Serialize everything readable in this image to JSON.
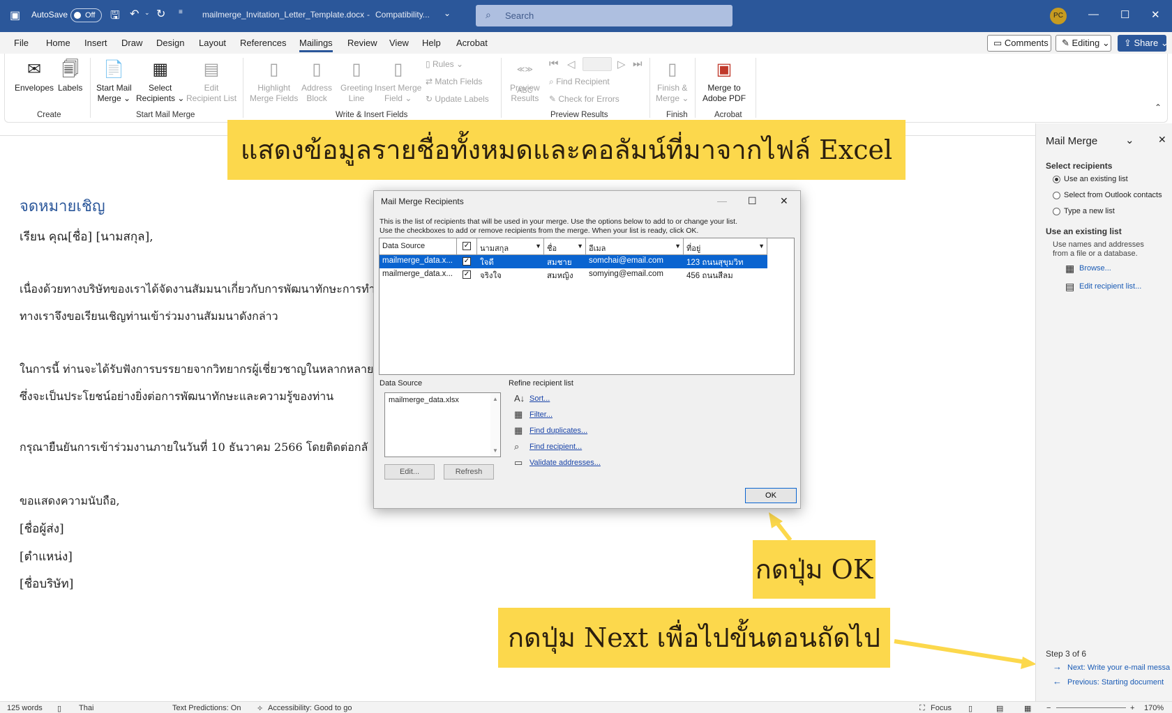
{
  "titlebar": {
    "autosave_label": "AutoSave",
    "autosave_state": "Off",
    "filename": "mailmerge_Invitation_Letter_Template.docx",
    "mode": "Compatibility...",
    "search_placeholder": "Search",
    "avatar": "PC"
  },
  "menu": {
    "tabs": [
      "File",
      "Home",
      "Insert",
      "Draw",
      "Design",
      "Layout",
      "References",
      "Mailings",
      "Review",
      "View",
      "Help",
      "Acrobat"
    ],
    "comments": "Comments",
    "editing": "Editing",
    "share": "Share"
  },
  "ribbon": {
    "envelopes": "Envelopes",
    "labels": "Labels",
    "start_mail_merge": [
      "Start Mail",
      "Merge"
    ],
    "select_recipients": [
      "Select",
      "Recipients"
    ],
    "edit_recipient_list": [
      "Edit",
      "Recipient List"
    ],
    "highlight_merge_fields": [
      "Highlight",
      "Merge Fields"
    ],
    "address_block": [
      "Address",
      "Block"
    ],
    "greeting_line": [
      "Greeting",
      "Line"
    ],
    "insert_merge_field": [
      "Insert Merge",
      "Field"
    ],
    "rules": "Rules",
    "match_fields": "Match Fields",
    "update_labels": "Update Labels",
    "preview_results": [
      "Preview",
      "Results"
    ],
    "find_recipient": "Find Recipient",
    "check_for_errors": "Check for Errors",
    "finish_merge": [
      "Finish &",
      "Merge"
    ],
    "merge_to_pdf": [
      "Merge to",
      "Adobe PDF"
    ],
    "groups": [
      "Create",
      "Start Mail Merge",
      "Write & Insert Fields",
      "Preview Results",
      "Finish",
      "Acrobat"
    ]
  },
  "document": {
    "heading": "จดหมายเชิญ",
    "lines": [
      "เรียน คุณ[ชื่อ] [นามสกุล],",
      "เนื่องด้วยทางบริษัทของเราได้จัดงานสัมมนาเกี่ยวกับการพัฒนาทักษะการทำงา",
      "ทางเราจึงขอเรียนเชิญท่านเข้าร่วมงานสัมมนาดังกล่าว",
      "ในการนี้ ท่านจะได้รับฟังการบรรยายจากวิทยากรผู้เชี่ยวชาญในหลากหลายสา",
      "ซึ่งจะเป็นประโยชน์อย่างยิ่งต่อการพัฒนาทักษะและความรู้ของท่าน",
      "กรุณายืนยันการเข้าร่วมงานภายในวันที่ 10 ธันวาคม 2566 โดยติดต่อกลั",
      "ขอแสดงความนับถือ,",
      "[ชื่อผู้ส่ง]",
      "[ตำแหน่ง]",
      "[ชื่อบริษัท]"
    ]
  },
  "annotations": {
    "top": "แสดงข้อมูลรายชื่อทั้งหมดและคอลัมน์ที่มาจากไฟล์ Excel",
    "ok": "กดปุ่ม OK",
    "next": "กดปุ่ม Next เพื่อไปขั้นตอนถัดไป"
  },
  "dialog": {
    "title": "Mail Merge Recipients",
    "description": [
      "This is the list of recipients that will be used in your merge.  Use the options below to add to or change your list.",
      "Use the checkboxes to add or remove recipients from the merge.  When your list is ready, click OK."
    ],
    "columns": [
      "Data Source",
      "",
      "นามสกุล",
      "ชื่อ",
      "อีเมล",
      "ที่อยู่"
    ],
    "rows": [
      {
        "source": "mailmerge_data.x...",
        "checked": "✓",
        "lastname": "ใจดี",
        "firstname": "สมชาย",
        "email": "somchai@email.com",
        "address": "123 ถนนสุขุมวิท"
      },
      {
        "source": "mailmerge_data.x...",
        "checked": "✓",
        "lastname": "จริงใจ",
        "firstname": "สมหญิง",
        "email": "somying@email.com",
        "address": "456 ถนนสีลม"
      }
    ],
    "data_source_label": "Data Source",
    "data_source_file": "mailmerge_data.xlsx",
    "edit_btn": "Edit...",
    "refresh_btn": "Refresh",
    "refine_label": "Refine recipient list",
    "refine_links": [
      "Sort...",
      "Filter...",
      "Find duplicates...",
      "Find recipient...",
      "Validate addresses..."
    ],
    "ok_btn": "OK"
  },
  "pane": {
    "title": "Mail Merge",
    "select_recipients": "Select recipients",
    "options": [
      "Use an existing list",
      "Select from Outlook contacts",
      "Type a new list"
    ],
    "existing_heading": "Use an existing list",
    "existing_desc": [
      "Use names and addresses",
      "from a file or a database."
    ],
    "browse": "Browse...",
    "edit_list": "Edit recipient list...",
    "step": "Step 3 of 6",
    "next": "Next: Write your e-mail messa",
    "previous": "Previous: Starting document"
  },
  "status": {
    "words": "125 words",
    "language": "Thai",
    "predictions": "Text Predictions: On",
    "accessibility": "Accessibility: Good to go",
    "focus": "Focus",
    "zoom": "170%"
  }
}
